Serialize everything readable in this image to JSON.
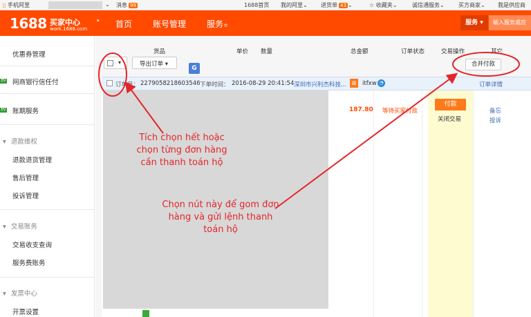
{
  "topbar": {
    "mobile": "手机阿里",
    "messages": "消息",
    "messages_count": "99",
    "home_1688": "1688首页",
    "my_ali": "我的阿里",
    "purchase": "进货单",
    "purchase_count": "43",
    "favorites": "收藏夹",
    "trust": "诚信通服务",
    "buyer": "买方商家",
    "supplier": "我是供应商"
  },
  "header": {
    "logo": "1688",
    "center": "买家中心",
    "domain": "work.1688.com",
    "nav": [
      "首页",
      "账号管理",
      "服务"
    ],
    "service_btn": "服务",
    "search_placeholder": "输入服务或应"
  },
  "sidebar": {
    "items": [
      {
        "label": "优惠券管理"
      },
      {
        "label": "网商银行信任付",
        "badge": "EV"
      },
      {
        "label": "账期服务",
        "badge": "EV"
      }
    ],
    "groups": [
      {
        "title": "退款维权",
        "items": [
          "退款退货管理",
          "售后管理",
          "投诉管理"
        ]
      },
      {
        "title": "交易账务",
        "items": [
          "交易收支查询",
          "服务费账务"
        ]
      },
      {
        "title": "发票中心",
        "items": [
          "开票设置"
        ]
      }
    ]
  },
  "table": {
    "headers": [
      "货品",
      "单价",
      "数量",
      "总金额",
      "订单状态",
      "交易操作",
      "其它"
    ],
    "export_btn": "导出订单",
    "merge_pay_btn": "合并付款"
  },
  "order": {
    "order_label": "订单号：",
    "order_no": "2279058218603546",
    "time_label": "下单时间：",
    "time": "2016-08-29 20:41:54",
    "seller": "深圳市兴利杰科技...",
    "seller_id": "itfxw",
    "detail_link": "订单详情",
    "amount": "187.80",
    "status": "等待买家付款",
    "pay_btn": "付款",
    "close": "关闭交易",
    "memo": "备忘",
    "complain": "投诉"
  },
  "annotations": {
    "note1": "Tích chọn hết hoặc chọn từng đơn hàng cần thanh toán hộ",
    "note2": "Chọn nút này để gom đơn hàng và gửi lệnh thanh toán hộ"
  },
  "colors": {
    "brand": "#ff4a00",
    "annotation": "#e3262a"
  }
}
